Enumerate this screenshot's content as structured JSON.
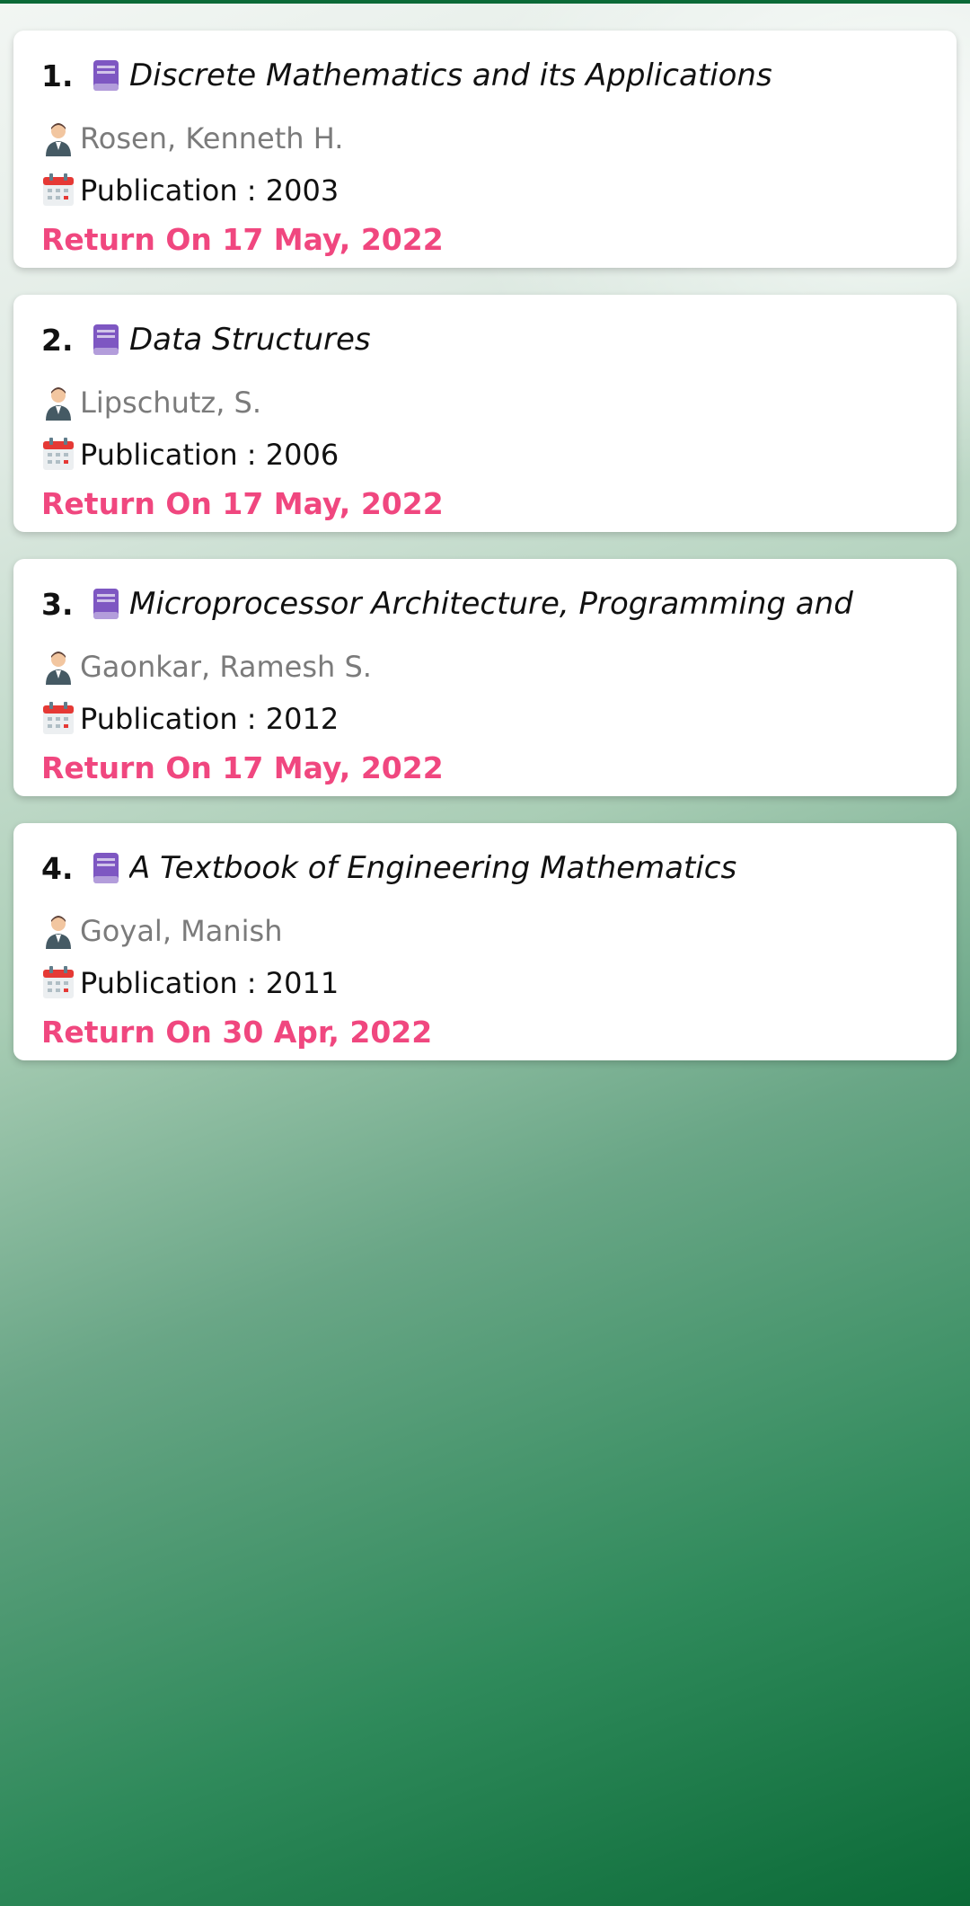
{
  "books": [
    {
      "number": "1.",
      "title": "Discrete Mathematics and its Applications",
      "author": "Rosen, Kenneth H.",
      "publication": "Publication : 2003",
      "return": "Return On 17 May, 2022"
    },
    {
      "number": "2.",
      "title": "Data Structures",
      "author": "Lipschutz, S.",
      "publication": "Publication : 2006",
      "return": "Return On 17 May, 2022"
    },
    {
      "number": "3.",
      "title": "Microprocessor Architecture, Programming and",
      "author": "Gaonkar, Ramesh S.",
      "publication": "Publication : 2012",
      "return": "Return On 17 May, 2022"
    },
    {
      "number": "4.",
      "title": "A Textbook of Engineering Mathematics",
      "author": "Goyal, Manish",
      "publication": "Publication : 2011",
      "return": "Return On 30 Apr, 2022"
    }
  ],
  "icons": {
    "title": "book-icon",
    "author": "person-icon",
    "publication": "calendar-icon"
  },
  "colors": {
    "return_text": "#f0477f",
    "author_text": "#7b7b7b",
    "top_strip": "#0b6a37"
  }
}
